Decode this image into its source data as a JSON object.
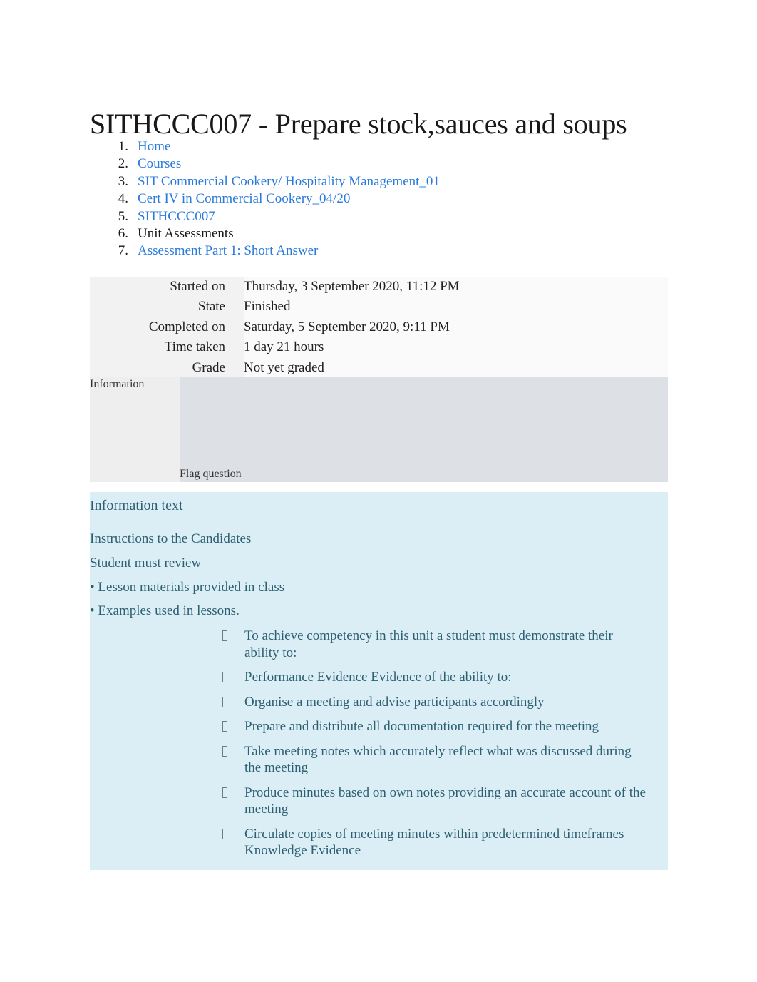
{
  "page": {
    "title": "SITHCCC007 - Prepare stock,sauces and soups"
  },
  "breadcrumb": {
    "items": [
      {
        "num": "1.",
        "label": "Home",
        "is_link": true
      },
      {
        "num": "2.",
        "label": "Courses",
        "is_link": true
      },
      {
        "num": "3.",
        "label": "SIT Commercial Cookery/ Hospitality Management_01",
        "is_link": true
      },
      {
        "num": "4.",
        "label": "Cert IV in Commercial Cookery_04/20",
        "is_link": true
      },
      {
        "num": "5.",
        "label": "SITHCCC007",
        "is_link": true
      },
      {
        "num": "6.",
        "label": "Unit Assessments",
        "is_link": false
      },
      {
        "num": "7.",
        "label": "Assessment Part 1: Short Answer",
        "is_link": true
      }
    ],
    "link_color": "#2a7ade"
  },
  "summary": {
    "rows": [
      {
        "label": "Started on",
        "value": "Thursday, 3 September 2020, 11:12 PM"
      },
      {
        "label": "State",
        "value": "Finished"
      },
      {
        "label": "Completed on",
        "value": "Saturday, 5 September 2020, 9:11 PM"
      },
      {
        "label": "Time taken",
        "value": "1 day 21 hours"
      },
      {
        "label": "Grade",
        "value": "Not yet graded"
      }
    ]
  },
  "question_block": {
    "info_label": "Information",
    "flag_label": "Flag question",
    "left_bg": "#eeeeee",
    "right_bg": "#dde1e6"
  },
  "information_panel": {
    "bg": "#dbeef5",
    "text_color": "#2d5f73",
    "heading": "Information text",
    "paragraphs": [
      "Instructions to the Candidates",
      "Student must review",
      "• Lesson materials provided in class",
      "• Examples used in lessons."
    ],
    "evidence_items": [
      "To achieve competency in this unit a student must demonstrate their ability to:",
      "Performance Evidence Evidence of the ability to:",
      " Organise a meeting and advise participants accordingly",
      "Prepare and distribute all documentation required for the meeting",
      "Take meeting notes which accurately reflect what was discussed during the meeting",
      "Produce minutes based on own notes providing an accurate account of the meeting",
      "Circulate copies of meeting minutes within predetermined timeframes Knowledge Evidence"
    ]
  }
}
